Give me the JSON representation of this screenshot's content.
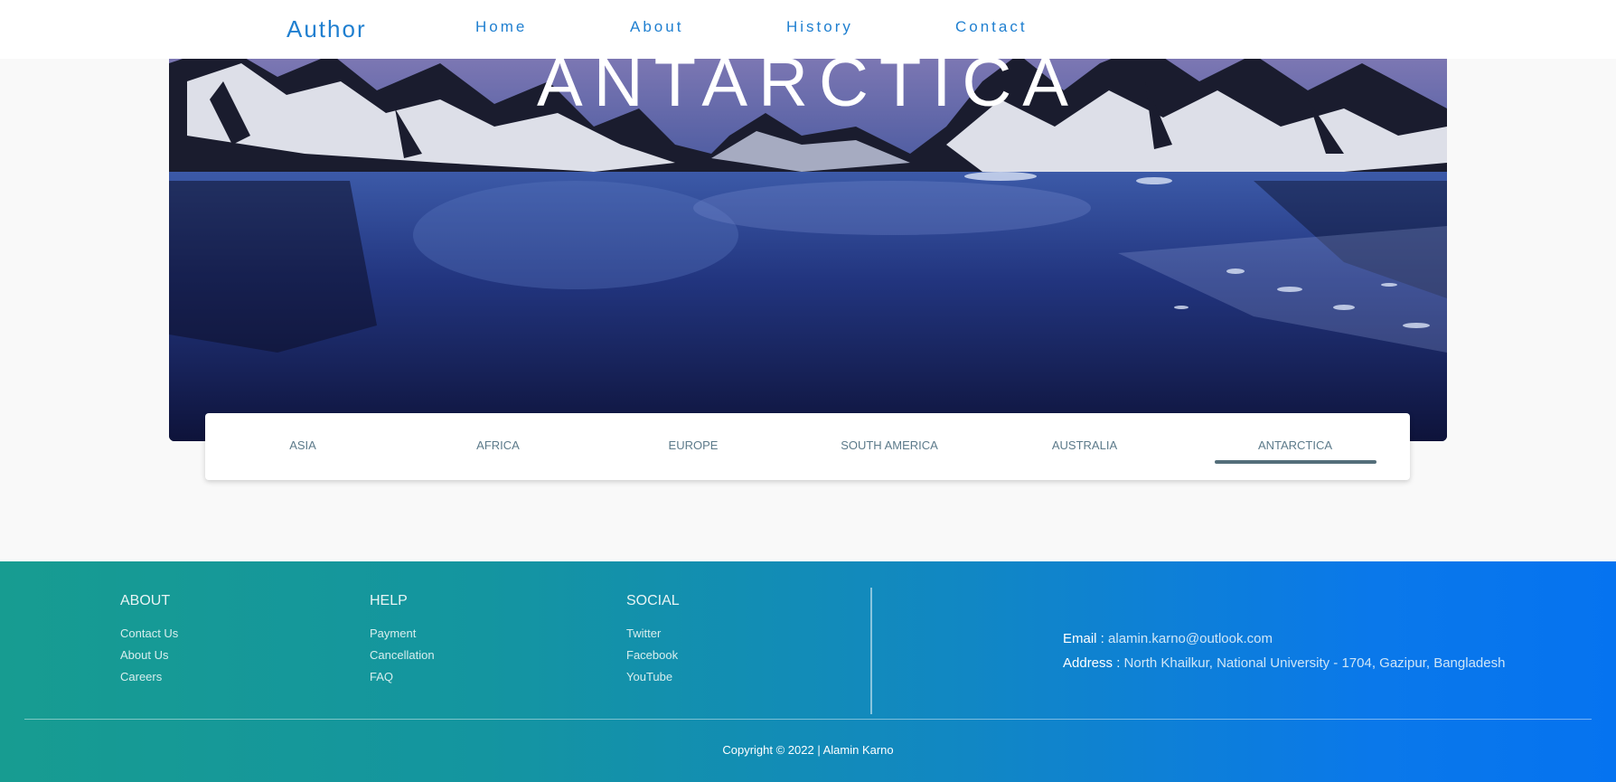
{
  "navbar": {
    "brand": "Author",
    "links": [
      "Home",
      "About",
      "History",
      "Contact"
    ]
  },
  "hero": {
    "title": "ANTARCTICA"
  },
  "tabs": {
    "items": [
      "ASIA",
      "AFRICA",
      "EUROPE",
      "SOUTH AMERICA",
      "AUSTRALIA",
      "ANTARCTICA"
    ],
    "active": "ANTARCTICA"
  },
  "footer": {
    "about": {
      "heading": "ABOUT",
      "links": [
        "Contact Us",
        "About Us",
        "Careers"
      ]
    },
    "help": {
      "heading": "HELP",
      "links": [
        "Payment",
        "Cancellation",
        "FAQ"
      ]
    },
    "social": {
      "heading": "SOCIAL",
      "links": [
        "Twitter",
        "Facebook",
        "YouTube"
      ]
    },
    "email_label": "Email :",
    "email_value": "alamin.karno@outlook.com",
    "address_label": "Address :",
    "address_value": "North Khailkur, National University - 1704, Gazipur, Bangladesh",
    "copyright": "Copyright © 2022 | Alamin Karno"
  },
  "colors": {
    "brand": "#1f7fd0",
    "footer_start": "#179c91",
    "footer_end": "#0573f0",
    "tab_text": "#5c7a8a",
    "tab_indicator": "#546e7a"
  }
}
